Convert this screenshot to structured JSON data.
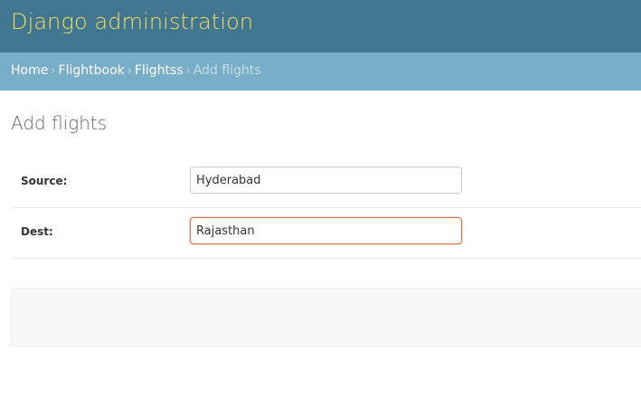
{
  "header": {
    "site_name": "Django administration"
  },
  "breadcrumbs": {
    "items": [
      "Home",
      "Flightbook",
      "Flightss"
    ],
    "separator": "›",
    "current": "Add flights"
  },
  "page": {
    "title": "Add flights"
  },
  "form": {
    "fields": [
      {
        "label": "Source:",
        "value": "Hyderabad"
      },
      {
        "label": "Dest:",
        "value": "Rajasthan"
      }
    ]
  },
  "colors": {
    "header_bg": "#417690",
    "branding": "#f5dd5d",
    "breadcrumbs_bg": "#79aec8",
    "focus_border": "#d9714f"
  }
}
